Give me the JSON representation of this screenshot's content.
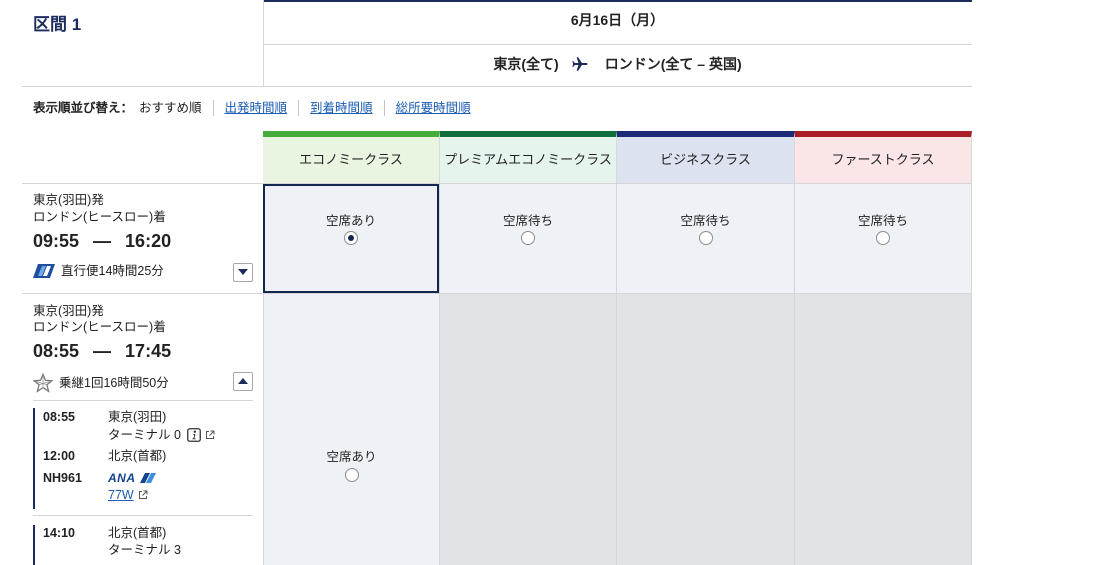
{
  "segment_header": {
    "title": "区間 1",
    "date": "6月16日（月）",
    "origin": "東京(全て)",
    "destination": "ロンドン(全て – 英国)",
    "route_icon": "airplane-icon"
  },
  "sort": {
    "label": "表示順並び替え：",
    "current": "おすすめ順",
    "options": [
      "出発時間順",
      "到着時間順",
      "総所要時間順"
    ]
  },
  "colors": {
    "navy": "#1b2c5c",
    "link": "#1d5cb4",
    "selected_border": "#13284f",
    "selectable_bg": "#eef1f6",
    "unavailable_bg": "#e2e3e6"
  },
  "classes": [
    {
      "label": "エコノミークラス",
      "accent": "#45ab3a",
      "bg": "#eaf5e1"
    },
    {
      "label": "プレミアムエコノミークラス",
      "accent": "#0f6e3c",
      "bg": "#e6f4ee"
    },
    {
      "label": "ビジネスクラス",
      "accent": "#1d2a78",
      "bg": "#dde2f1"
    },
    {
      "label": "ファーストクラス",
      "accent": "#a91f25",
      "bg": "#fae6e6"
    }
  ],
  "time_separator": "—",
  "flights": [
    {
      "departure": "東京(羽田)発",
      "arrival": "ロンドン(ヒースロー)着",
      "dep_time": "09:55",
      "arr_time": "16:20",
      "summary": "直行便14時間25分",
      "carrier_icon": "ana-tail-logo-icon",
      "expanded": false,
      "fares": [
        {
          "status": "空席あり",
          "selectable": true,
          "selected": true
        },
        {
          "status": "空席待ち",
          "selectable": true,
          "selected": false
        },
        {
          "status": "空席待ち",
          "selectable": true,
          "selected": false
        },
        {
          "status": "空席待ち",
          "selectable": true,
          "selected": false
        }
      ]
    },
    {
      "departure": "東京(羽田)発",
      "arrival": "ロンドン(ヒースロー)着",
      "dep_time": "08:55",
      "arr_time": "17:45",
      "summary": "乗継1回16時間50分",
      "carrier_icon": "star-alliance-icon",
      "expanded": true,
      "fares": [
        {
          "status": "空席あり",
          "selectable": true,
          "selected": false
        },
        {
          "selectable": false,
          "selected": false
        },
        {
          "selectable": false,
          "selected": false
        },
        {
          "selectable": false,
          "selected": false
        }
      ],
      "segments": [
        {
          "dep_time": "08:55",
          "dep_airport": "東京(羽田)",
          "dep_terminal": "ターミナル 0",
          "arr_time": "12:00",
          "arr_airport": "北京(首都)",
          "flight_number": "NH961",
          "airline_logo": "ANA",
          "aircraft": "77W"
        },
        {
          "dep_time": "14:10",
          "dep_airport": "北京(首都)",
          "dep_terminal": "ターミナル 3"
        }
      ]
    }
  ]
}
